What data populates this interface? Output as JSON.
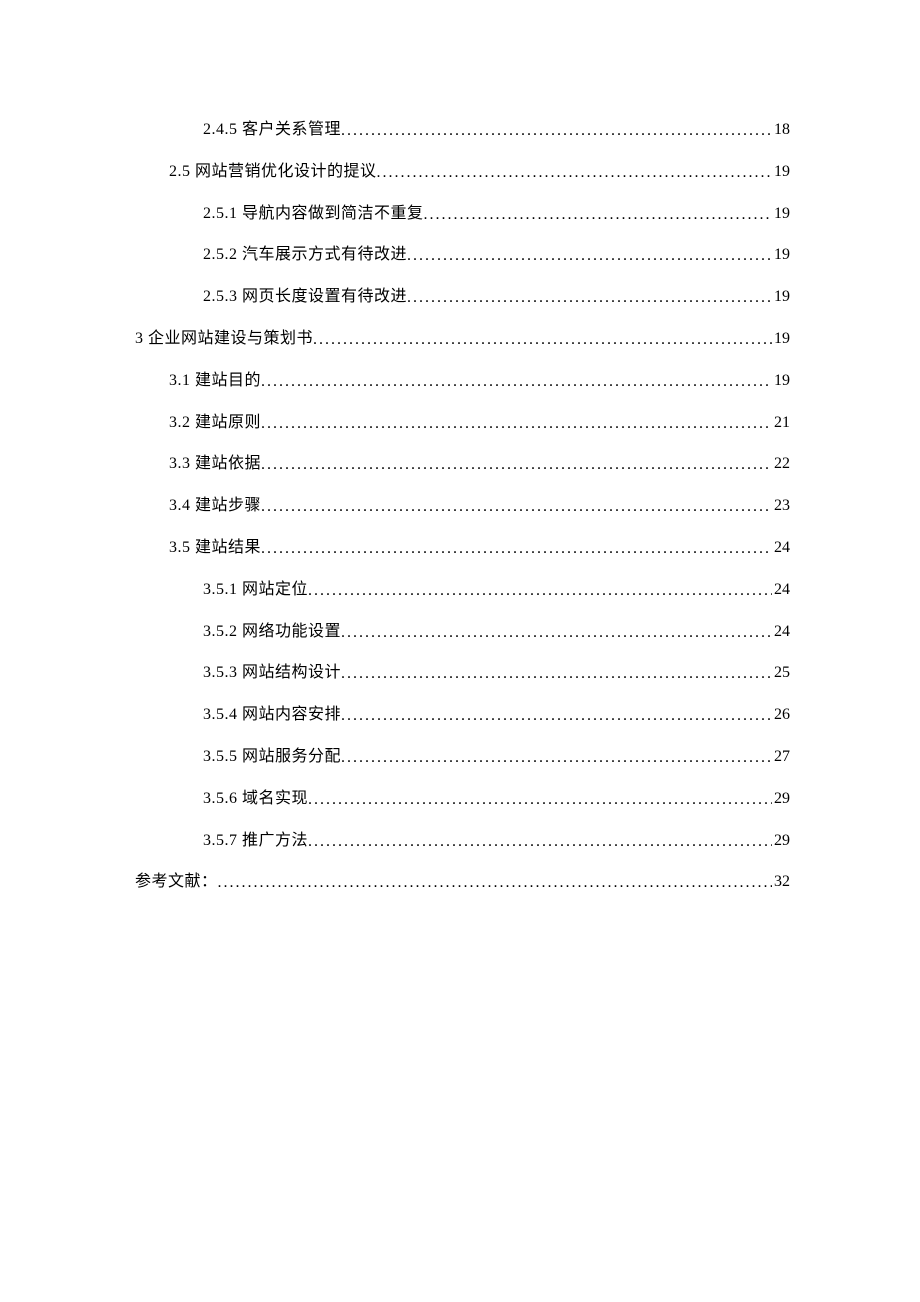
{
  "toc": [
    {
      "indent": 2,
      "label": "2.4.5 客户关系管理",
      "page": "18"
    },
    {
      "indent": 1,
      "label": "2.5 网站营销优化设计的提议",
      "page": "19"
    },
    {
      "indent": 2,
      "label": "2.5.1 导航内容做到简洁不重复",
      "page": "19"
    },
    {
      "indent": 2,
      "label": "2.5.2 汽车展示方式有待改进",
      "page": "19"
    },
    {
      "indent": 2,
      "label": "2.5.3 网页长度设置有待改进",
      "page": "19"
    },
    {
      "indent": 0,
      "label": "3  企业网站建设与策划书",
      "page": "19"
    },
    {
      "indent": 1,
      "label": "3.1 建站目的",
      "page": "19"
    },
    {
      "indent": 1,
      "label": "3.2 建站原则",
      "page": "21"
    },
    {
      "indent": 1,
      "label": "3.3 建站依据",
      "page": "22"
    },
    {
      "indent": 1,
      "label": "3.4 建站步骤",
      "page": "23"
    },
    {
      "indent": 1,
      "label": "3.5 建站结果",
      "page": "24"
    },
    {
      "indent": 2,
      "label": "3.5.1 网站定位",
      "page": "24"
    },
    {
      "indent": 2,
      "label": "3.5.2 网络功能设置",
      "page": "24"
    },
    {
      "indent": 2,
      "label": "3.5.3 网站结构设计",
      "page": "25"
    },
    {
      "indent": 2,
      "label": "3.5.4 网站内容安排",
      "page": "26"
    },
    {
      "indent": 2,
      "label": "3.5.5 网站服务分配",
      "page": "27"
    },
    {
      "indent": 2,
      "label": "3.5.6 域名实现",
      "page": "29"
    },
    {
      "indent": 2,
      "label": "3.5.7 推广方法",
      "page": "29"
    },
    {
      "indent": 0,
      "label": "参考文献：",
      "page": "32"
    }
  ]
}
